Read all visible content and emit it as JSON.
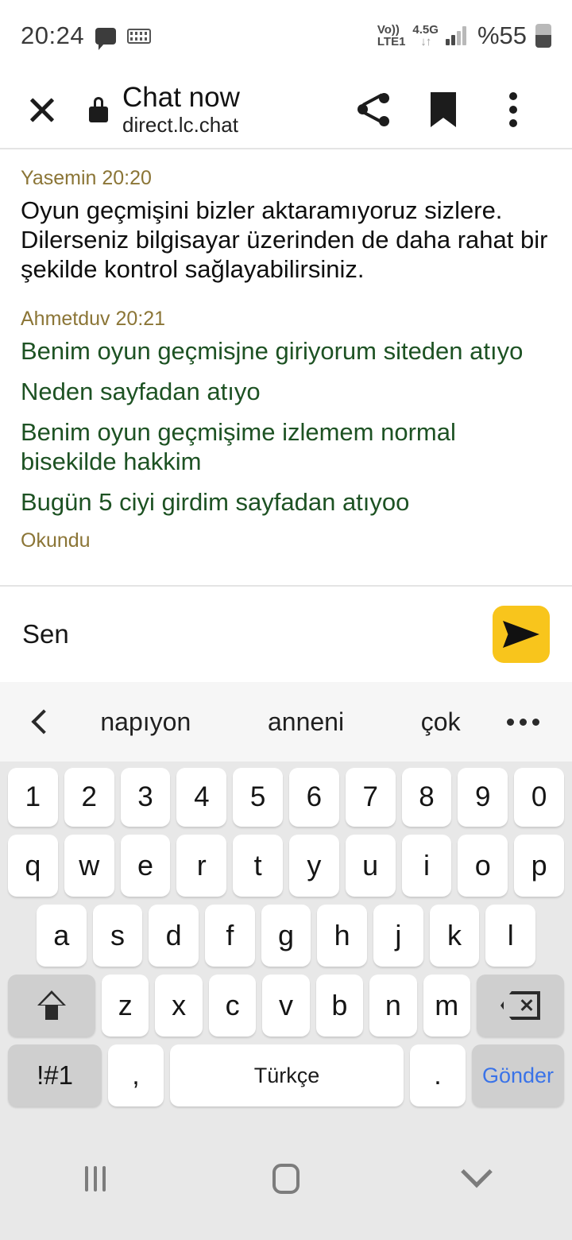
{
  "status_bar": {
    "time": "20:24",
    "message_icon": "message-icon",
    "keyboard_icon": "keyboard-icon",
    "volte_label_top": "Vo))",
    "volte_label_bottom": "LTE1",
    "network_generation": "4.5G",
    "data_arrows": "↓↑",
    "signal_bars_filled": 2,
    "signal_bars_total": 4,
    "battery_percent": "%55"
  },
  "toolbar": {
    "close_icon": "close-icon",
    "lock_icon": "lock-icon",
    "title": "Chat now",
    "url": "direct.lc.chat",
    "share_icon": "share-icon",
    "bookmark_icon": "bookmark-icon",
    "more_icon": "more-vertical-icon"
  },
  "chat": {
    "groups": [
      {
        "meta": "Yasemin 20:20",
        "role": "agent",
        "messages": [
          "Oyun geçmişini bizler aktaramıyoruz sizlere. Dilerseniz bilgisayar üzerinden de daha rahat bir şekilde kontrol sağlayabilirsiniz."
        ]
      },
      {
        "meta": "Ahmetduv 20:21",
        "role": "user",
        "messages": [
          "Benim oyun geçmisjne giriyorum siteden atıyo",
          "Neden sayfadan atıyo",
          "Benim oyun geçmişime izlemem normal bisekilde hakkim",
          "Bugün 5 ciyi girdim sayfadan atıyoo"
        ],
        "receipt": "Okundu"
      }
    ]
  },
  "composer": {
    "input_value": "Sen",
    "placeholder": "Sen",
    "send_icon": "send-icon"
  },
  "keyboard": {
    "back_icon": "chevron-left-icon",
    "suggestions": [
      "napıyon",
      "anneni",
      "çok"
    ],
    "more_icon": "more-horizontal-icon",
    "rows": {
      "numbers": [
        "1",
        "2",
        "3",
        "4",
        "5",
        "6",
        "7",
        "8",
        "9",
        "0"
      ],
      "top": [
        "q",
        "w",
        "e",
        "r",
        "t",
        "y",
        "u",
        "i",
        "o",
        "p"
      ],
      "home": [
        "a",
        "s",
        "d",
        "f",
        "g",
        "h",
        "j",
        "k",
        "l"
      ],
      "bottom": [
        "z",
        "x",
        "c",
        "v",
        "b",
        "n",
        "m"
      ]
    },
    "shift_icon": "shift-icon",
    "backspace_icon": "backspace-icon",
    "symbols_key": "!#1",
    "comma_key": ",",
    "space_key": "Türkçe",
    "period_key": ".",
    "send_key": "Gönder"
  },
  "navbar": {
    "recents_icon": "recents-icon",
    "home_icon": "home-icon",
    "hide_keyboard_icon": "chevron-down-icon"
  },
  "colors": {
    "accent_send": "#f8c51c",
    "agent_meta": "#8b7536",
    "user_text": "#1d5223",
    "send_key_text": "#3a73e8"
  }
}
